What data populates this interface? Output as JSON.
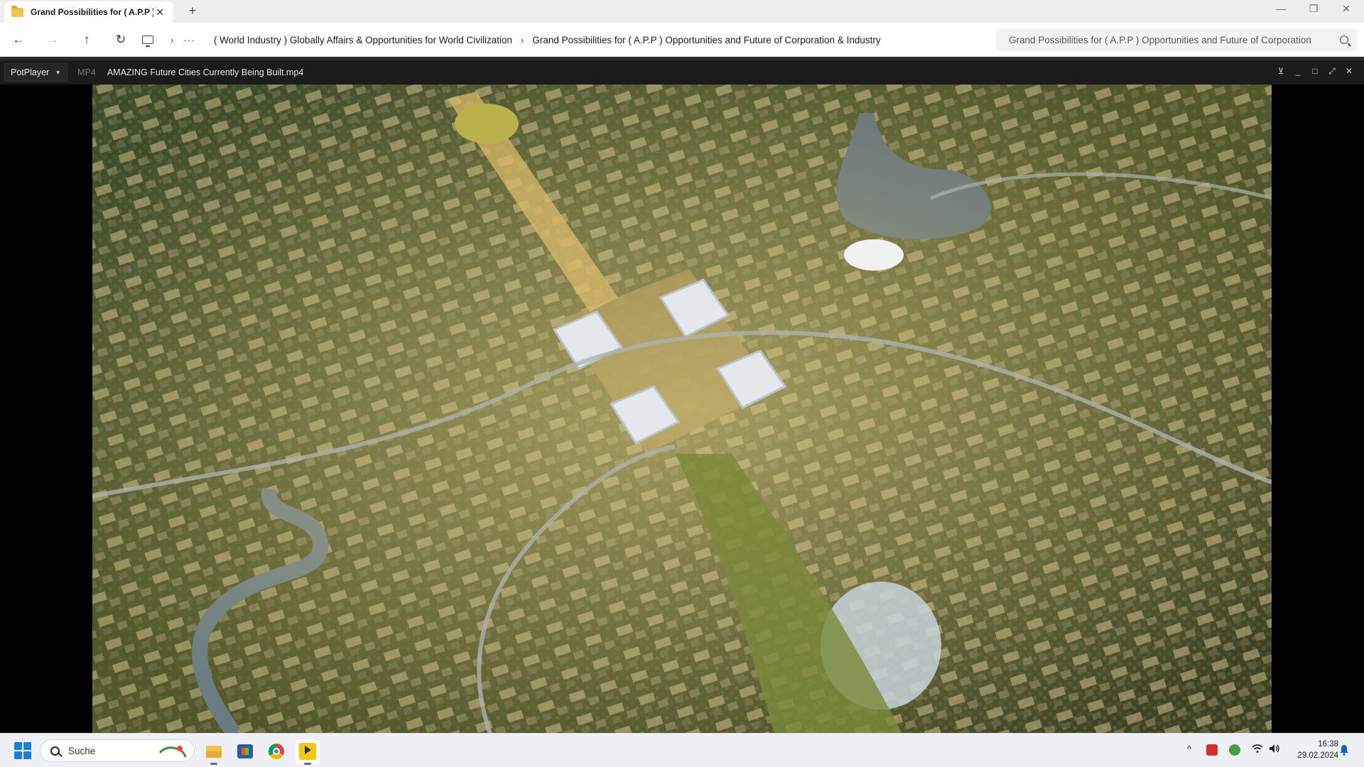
{
  "explorer": {
    "tab_title": "Grand Possibilities for ( A.P.P )",
    "tab_close": "✕",
    "new_tab": "+",
    "window_controls": {
      "minimize": "—",
      "maximize": "❐",
      "close": "✕"
    },
    "nav": {
      "back": "←",
      "forward": "→",
      "up": "↑",
      "refresh": "↻"
    },
    "breadcrumb_more": "···",
    "breadcrumbs": [
      "( World Industry ) Globally Affairs & Opportunities for World Civilization",
      "Grand Possibilities for ( A.P.P ) Opportunities and Future of Corporation & Industry"
    ],
    "search_placeholder": "Grand Possibilities for ( A.P.P ) Opportunities and Future of Corporation"
  },
  "player": {
    "menu_label": "PotPlayer",
    "format": "MP4",
    "file_name": "AMAZING Future Cities Currently Being Built.mp4",
    "controls": {
      "pin": "⊻",
      "minimize": "_",
      "maximize": "□",
      "fullscreen": "⤢",
      "close": "✕"
    }
  },
  "taskbar": {
    "search_label": "Suche",
    "apps": [
      "file-explorer",
      "microsoft-store",
      "chrome",
      "potplayer"
    ],
    "tray": {
      "chevron": "^",
      "wifi": "wifi-icon",
      "volume": "volume-icon"
    },
    "clock_time": "16:38",
    "clock_date": "29.02.2024"
  },
  "colors": {
    "accent_windows": "#1a7fd8",
    "potplayer_yellow": "#f5c518",
    "player_bar": "#1b1b1b"
  }
}
